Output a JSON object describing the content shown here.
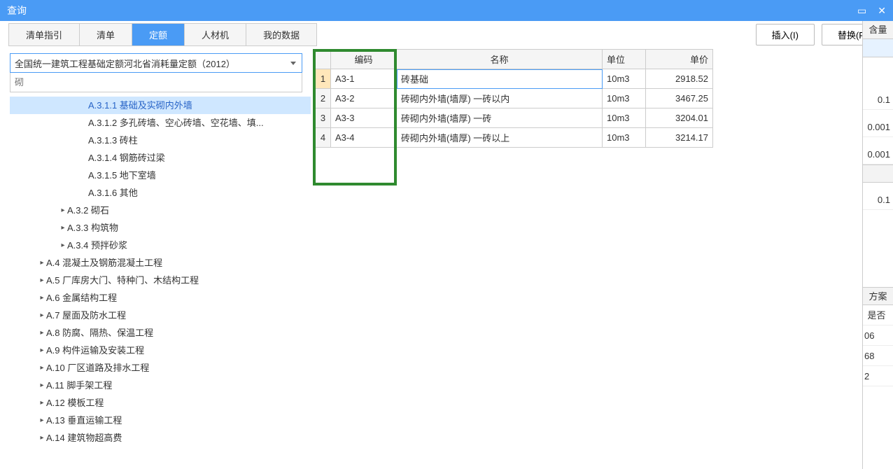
{
  "window": {
    "title": "查询",
    "minimize": "▭",
    "close": "✕"
  },
  "tabs": [
    "清单指引",
    "清单",
    "定额",
    "人材机",
    "我的数据"
  ],
  "active_tab": 2,
  "actions": {
    "insert": "插入(I)",
    "replace": "替换(R)"
  },
  "dropdown": "全国统一建筑工程基础定额河北省消耗量定额（2012）",
  "search_placeholder": "砌",
  "tree": [
    {
      "indent": 100,
      "arrow": "",
      "label": "A.3.1.1 基础及实砌内外墙",
      "selected": true
    },
    {
      "indent": 100,
      "arrow": "",
      "label": "A.3.1.2 多孔砖墙、空心砖墙、空花墙、填..."
    },
    {
      "indent": 100,
      "arrow": "",
      "label": "A.3.1.3 砖柱"
    },
    {
      "indent": 100,
      "arrow": "",
      "label": "A.3.1.4 钢筋砖过梁"
    },
    {
      "indent": 100,
      "arrow": "",
      "label": "A.3.1.5 地下室墙"
    },
    {
      "indent": 100,
      "arrow": "",
      "label": "A.3.1.6 其他"
    },
    {
      "indent": 70,
      "arrow": "▸",
      "label": "A.3.2 砌石"
    },
    {
      "indent": 70,
      "arrow": "▸",
      "label": "A.3.3 构筑物"
    },
    {
      "indent": 70,
      "arrow": "▸",
      "label": "A.3.4 预拌砂浆"
    },
    {
      "indent": 40,
      "arrow": "▸",
      "label": "A.4 混凝土及钢筋混凝土工程"
    },
    {
      "indent": 40,
      "arrow": "▸",
      "label": "A.5 厂库房大门、特种门、木结构工程"
    },
    {
      "indent": 40,
      "arrow": "▸",
      "label": "A.6 金属结构工程"
    },
    {
      "indent": 40,
      "arrow": "▸",
      "label": "A.7 屋面及防水工程"
    },
    {
      "indent": 40,
      "arrow": "▸",
      "label": "A.8 防腐、隔热、保温工程"
    },
    {
      "indent": 40,
      "arrow": "▸",
      "label": "A.9 构件运输及安装工程"
    },
    {
      "indent": 40,
      "arrow": "▸",
      "label": "A.10 厂区道路及排水工程"
    },
    {
      "indent": 40,
      "arrow": "▸",
      "label": "A.11 脚手架工程"
    },
    {
      "indent": 40,
      "arrow": "▸",
      "label": "A.12 模板工程"
    },
    {
      "indent": 40,
      "arrow": "▸",
      "label": "A.13 垂直运输工程"
    },
    {
      "indent": 40,
      "arrow": "▸",
      "label": "A.14 建筑物超高费"
    }
  ],
  "table": {
    "headers": {
      "code": "编码",
      "name": "名称",
      "unit": "单位",
      "price": "单价"
    },
    "rows": [
      {
        "n": "1",
        "code": "A3-1",
        "name": "砖基础",
        "unit": "10m3",
        "price": "2918.52",
        "sel": true
      },
      {
        "n": "2",
        "code": "A3-2",
        "name": "砖砌内外墙(墙厚) 一砖以内",
        "unit": "10m3",
        "price": "3467.25"
      },
      {
        "n": "3",
        "code": "A3-3",
        "name": "砖砌内外墙(墙厚) 一砖",
        "unit": "10m3",
        "price": "3204.01"
      },
      {
        "n": "4",
        "code": "A3-4",
        "name": "砖砌内外墙(墙厚) 一砖以上",
        "unit": "10m3",
        "price": "3214.17"
      }
    ]
  },
  "side": {
    "header1": "含量",
    "vals1": [
      "0.1",
      "0.001",
      "0.001",
      "",
      "0.1"
    ],
    "header2": "方案",
    "row2a": "是否",
    "row2b": "06",
    "row2c": "68",
    "row2d": "2"
  }
}
